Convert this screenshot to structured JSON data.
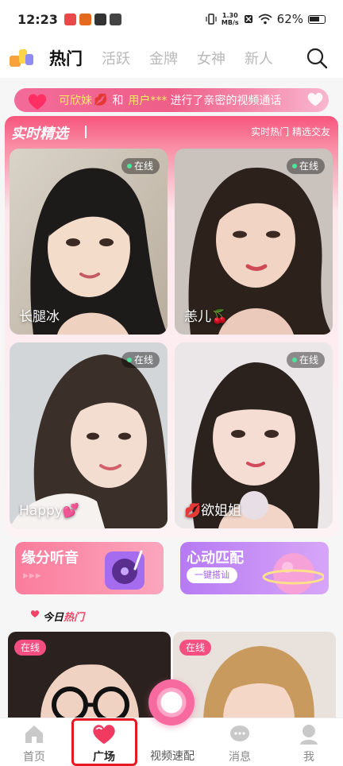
{
  "status_bar": {
    "time": "12:23",
    "speed_top": "1.30",
    "speed_bottom": "MB/s",
    "battery": "62%"
  },
  "top_tabs": [
    {
      "label": "热门",
      "active": true
    },
    {
      "label": "活跃"
    },
    {
      "label": "金牌"
    },
    {
      "label": "女神"
    },
    {
      "label": "新人"
    }
  ],
  "banner": {
    "user1": "可欣妹",
    "and": "和",
    "user2": "用户***",
    "action": "进行了亲密的视频通话"
  },
  "featured": {
    "title": "实时精选",
    "subtitle": "实时热门 精选交友",
    "cards": [
      {
        "name": "长腿冰",
        "status": "在线"
      },
      {
        "name": "恙儿🍒",
        "status": "在线"
      },
      {
        "name": "Happy💕",
        "status": "在线"
      },
      {
        "name": "💋欲姐姐",
        "status": "在线"
      }
    ]
  },
  "tiles": {
    "left": {
      "title": "缘分听音",
      "arrows": "▶▶▶"
    },
    "right": {
      "title": "心动匹配",
      "button": "一键搭讪"
    }
  },
  "today_hot": {
    "title_a": "今日",
    "title_b": "热门",
    "cards": [
      {
        "status": "在线"
      },
      {
        "status": "在线"
      }
    ]
  },
  "bottom_nav": {
    "home": "首页",
    "plaza": "广场",
    "video": "视频速配",
    "messages": "消息",
    "me": "我"
  }
}
